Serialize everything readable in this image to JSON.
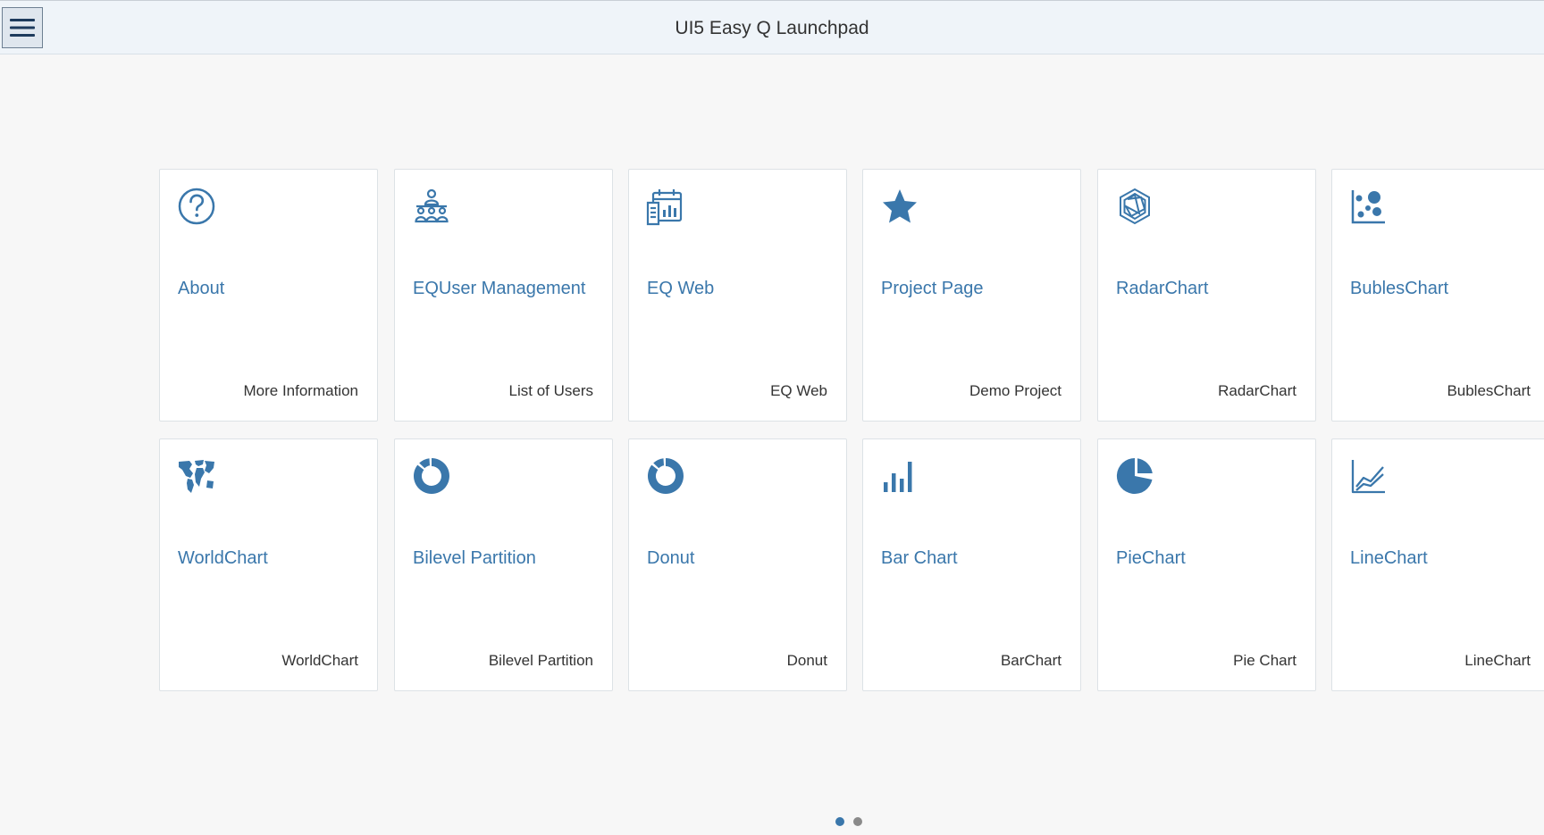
{
  "header": {
    "title": "UI5 Easy Q Launchpad",
    "menu_icon": "hamburger-menu-icon"
  },
  "colors": {
    "accent": "#3a77ab",
    "header_bg": "#eff4f9",
    "page_bg": "#f7f7f7",
    "dot_active": "#3a77ab",
    "dot_inactive": "#8a8a8a"
  },
  "tiles": [
    {
      "title": "About",
      "footer": "More Information",
      "icon": "question-circle-icon"
    },
    {
      "title": "EQUser Management",
      "footer": "List of Users",
      "icon": "group-users-icon"
    },
    {
      "title": "EQ Web",
      "footer": "EQ Web",
      "icon": "calendar-chart-icon"
    },
    {
      "title": "Project Page",
      "footer": "Demo Project",
      "icon": "star-icon"
    },
    {
      "title": "RadarChart",
      "footer": "RadarChart",
      "icon": "radar-chart-icon"
    },
    {
      "title": "BublesChart",
      "footer": "BublesChart",
      "icon": "bubble-chart-icon"
    },
    {
      "title": "WorldChart",
      "footer": "WorldChart",
      "icon": "world-map-icon"
    },
    {
      "title": "Bilevel Partition",
      "footer": "Bilevel Partition",
      "icon": "donut-chart-icon"
    },
    {
      "title": "Donut",
      "footer": "Donut",
      "icon": "donut-chart-icon"
    },
    {
      "title": "Bar Chart",
      "footer": "BarChart",
      "icon": "bar-chart-icon"
    },
    {
      "title": "PieChart",
      "footer": "Pie Chart",
      "icon": "pie-chart-icon"
    },
    {
      "title": "LineChart",
      "footer": "LineChart",
      "icon": "line-chart-icon"
    }
  ],
  "pagination": {
    "pages": 2,
    "current": 1
  }
}
